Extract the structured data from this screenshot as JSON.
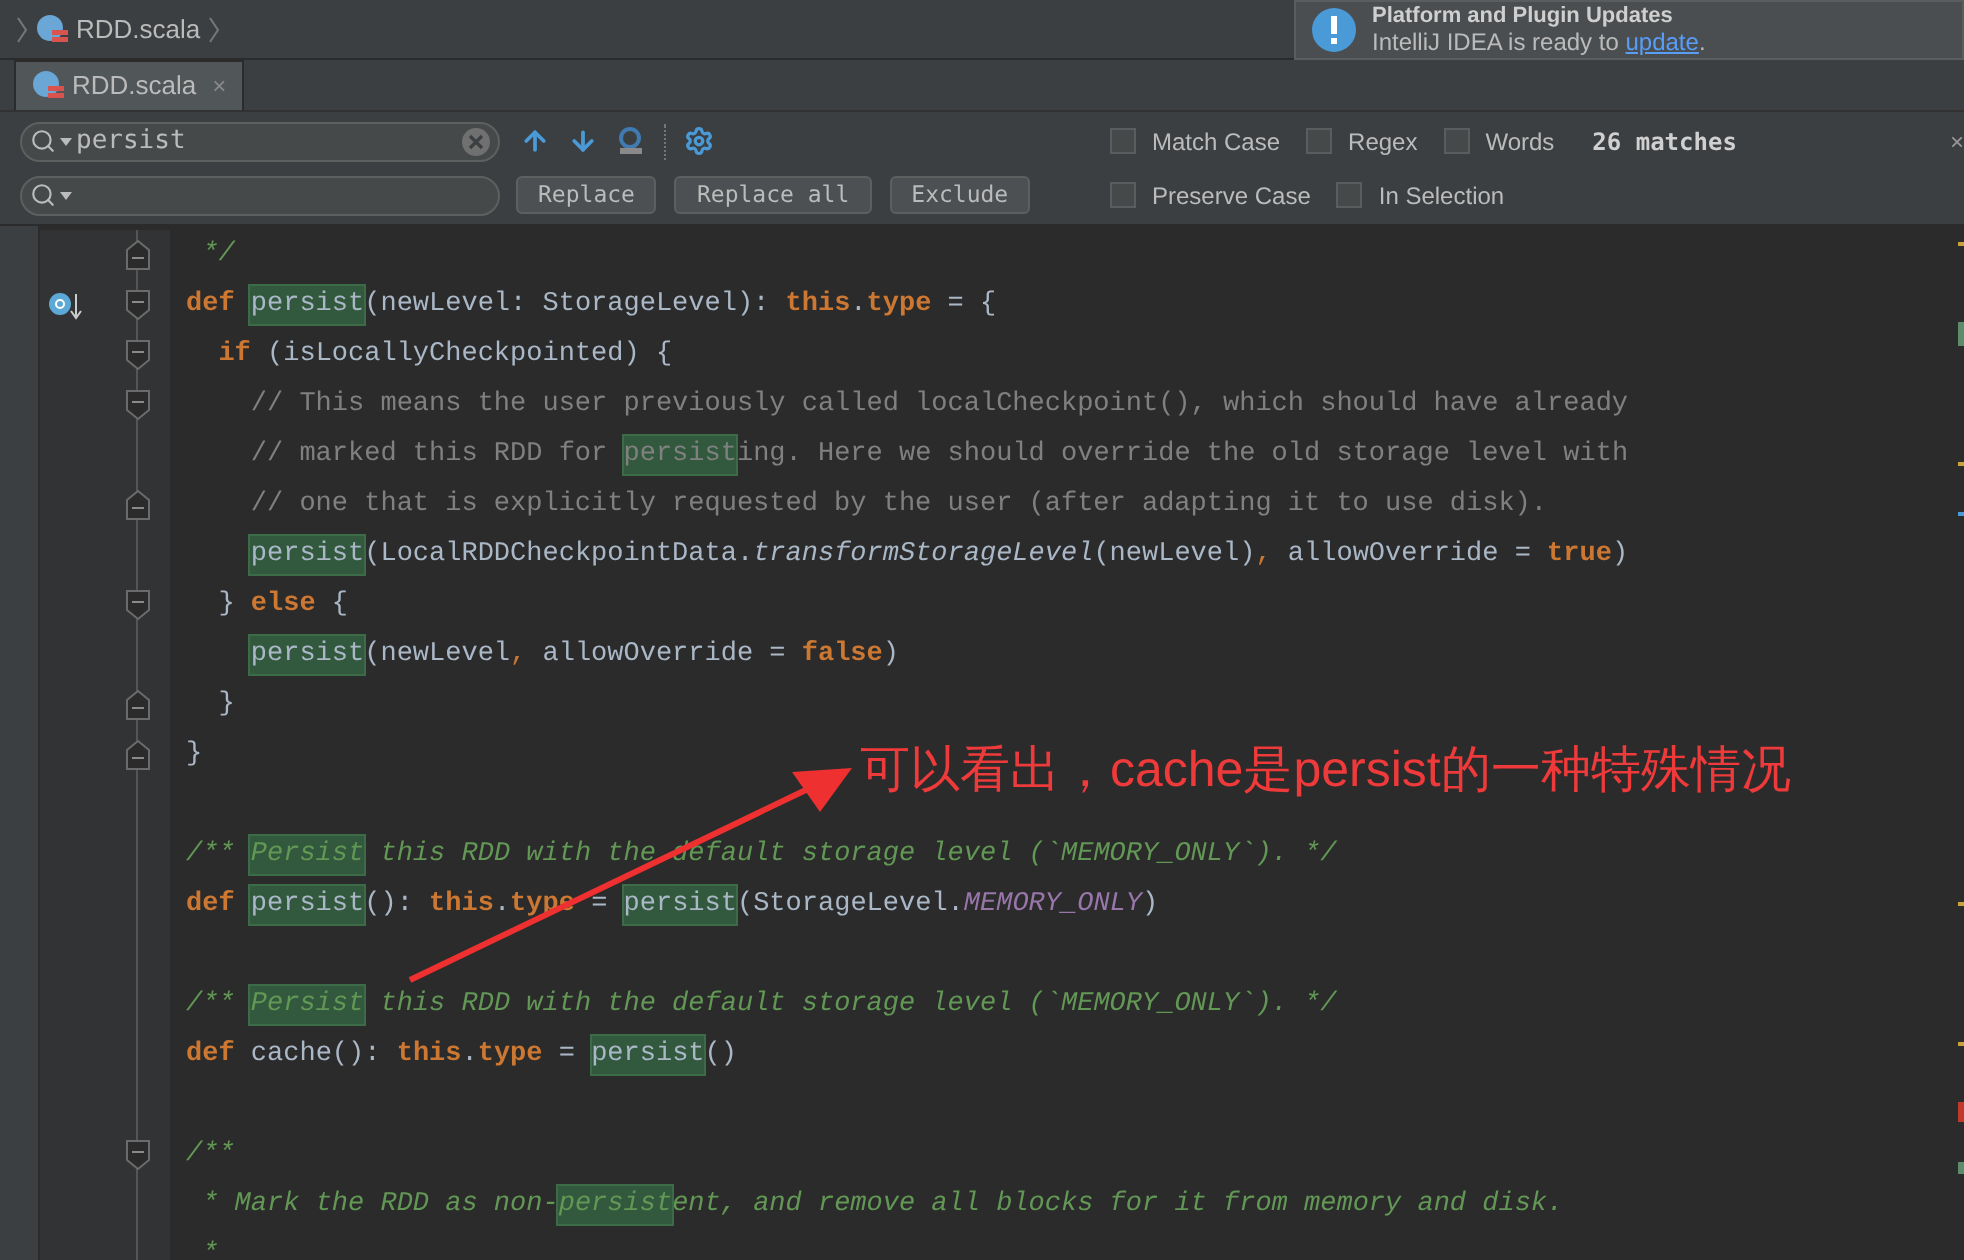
{
  "breadcrumb": {
    "file": "RDD.scala"
  },
  "tabs": [
    {
      "label": "RDD.scala",
      "selected": true,
      "close": "×"
    }
  ],
  "notification": {
    "title": "Platform and Plugin Updates",
    "text": "IntelliJ IDEA is ready to ",
    "link": "update",
    "end": "."
  },
  "search": {
    "value": "persist",
    "options": [
      {
        "label": "Match Case",
        "checked": false
      },
      {
        "label": "Regex",
        "checked": false
      },
      {
        "label": "Words",
        "checked": false
      }
    ],
    "matches": "26 matches",
    "close": "×"
  },
  "replace": {
    "buttons": [
      "Replace",
      "Replace all",
      "Exclude"
    ],
    "options": [
      {
        "label": "Preserve Case",
        "checked": false
      },
      {
        "label": "In Selection",
        "checked": false
      }
    ]
  },
  "code_lines": [
    {
      "fold_start": false,
      "fold_end": true,
      "override_marker": false,
      "tokens": [
        {
          "text": " */",
          "kind": "doc",
          "match": false
        }
      ]
    },
    {
      "fold_start": true,
      "fold_end": false,
      "override_marker": true,
      "tokens": [
        {
          "text": "def ",
          "kind": "keyword",
          "match": false
        },
        {
          "text": "persist",
          "kind": "plain",
          "match": true
        },
        {
          "text": "(newLevel: StorageLevel): ",
          "kind": "plain",
          "match": false
        },
        {
          "text": "this",
          "kind": "keyword",
          "match": false
        },
        {
          "text": ".",
          "kind": "plain",
          "match": false
        },
        {
          "text": "type",
          "kind": "keyword",
          "match": false
        },
        {
          "text": " = {",
          "kind": "plain",
          "match": false
        }
      ]
    },
    {
      "fold_start": true,
      "fold_end": false,
      "override_marker": false,
      "tokens": [
        {
          "text": "  if",
          "kind": "keyword",
          "match": false
        },
        {
          "text": " (isLocallyCheckpointed) {",
          "kind": "plain",
          "match": false
        }
      ]
    },
    {
      "fold_start": true,
      "fold_end": false,
      "override_marker": false,
      "tokens": [
        {
          "text": "    // This means the user previously called localCheckpoint(), which should have already",
          "kind": "comment",
          "match": false
        }
      ]
    },
    {
      "fold_start": false,
      "fold_end": false,
      "override_marker": false,
      "tokens": [
        {
          "text": "    // marked this RDD for ",
          "kind": "comment",
          "match": false
        },
        {
          "text": "persist",
          "kind": "comment",
          "match": true
        },
        {
          "text": "ing. Here we should override the old storage level with",
          "kind": "comment",
          "match": false
        }
      ]
    },
    {
      "fold_start": false,
      "fold_end": true,
      "override_marker": false,
      "tokens": [
        {
          "text": "    // one that is explicitly requested by the user (after adapting it to use disk).",
          "kind": "comment",
          "match": false
        }
      ]
    },
    {
      "fold_start": false,
      "fold_end": false,
      "override_marker": false,
      "tokens": [
        {
          "text": "    persist",
          "kind": "plain",
          "match": true
        },
        {
          "text": "(LocalRDDCheckpointData.",
          "kind": "plain",
          "match": false
        },
        {
          "text": "transformStorageLevel",
          "kind": "method",
          "match": false
        },
        {
          "text": "(newLevel)",
          "kind": "plain",
          "match": false
        },
        {
          "text": ", ",
          "kind": "punct",
          "match": false
        },
        {
          "text": "allowOverride = ",
          "kind": "plain",
          "match": false
        },
        {
          "text": "true",
          "kind": "keyword",
          "match": false
        },
        {
          "text": ")",
          "kind": "plain",
          "match": false
        }
      ]
    },
    {
      "fold_start": true,
      "fold_end": false,
      "override_marker": false,
      "tokens": [
        {
          "text": "  } ",
          "kind": "plain",
          "match": false
        },
        {
          "text": "else",
          "kind": "keyword",
          "match": false
        },
        {
          "text": " {",
          "kind": "plain",
          "match": false
        }
      ]
    },
    {
      "fold_start": false,
      "fold_end": false,
      "override_marker": false,
      "tokens": [
        {
          "text": "    persist",
          "kind": "plain",
          "match": true
        },
        {
          "text": "(newLevel",
          "kind": "plain",
          "match": false
        },
        {
          "text": ", ",
          "kind": "punct",
          "match": false
        },
        {
          "text": "allowOverride = ",
          "kind": "plain",
          "match": false
        },
        {
          "text": "false",
          "kind": "keyword",
          "match": false
        },
        {
          "text": ")",
          "kind": "plain",
          "match": false
        }
      ]
    },
    {
      "fold_start": false,
      "fold_end": true,
      "override_marker": false,
      "tokens": [
        {
          "text": "  }",
          "kind": "plain",
          "match": false
        }
      ]
    },
    {
      "fold_start": false,
      "fold_end": true,
      "override_marker": false,
      "tokens": [
        {
          "text": "}",
          "kind": "plain",
          "match": false
        }
      ]
    },
    {
      "fold_start": false,
      "fold_end": false,
      "override_marker": false
    },
    {
      "fold_start": false,
      "fold_end": false,
      "override_marker": false,
      "tokens": [
        {
          "text": "/** ",
          "kind": "doc",
          "match": false
        },
        {
          "text": "Persist",
          "kind": "doc",
          "match": true
        },
        {
          "text": " this RDD with the default storage level (`MEMORY_ONLY`). */",
          "kind": "doc",
          "match": false
        }
      ]
    },
    {
      "fold_start": false,
      "fold_end": false,
      "override_marker": false,
      "tokens": [
        {
          "text": "def ",
          "kind": "keyword",
          "match": false
        },
        {
          "text": "persist",
          "kind": "plain",
          "match": true
        },
        {
          "text": "(): ",
          "kind": "plain",
          "match": false
        },
        {
          "text": "this",
          "kind": "keyword",
          "match": false
        },
        {
          "text": ".",
          "kind": "plain",
          "match": false
        },
        {
          "text": "type",
          "kind": "keyword",
          "match": false
        },
        {
          "text": " = ",
          "kind": "plain",
          "match": false
        },
        {
          "text": "persist",
          "kind": "plain",
          "match": true
        },
        {
          "text": "(StorageLevel.",
          "kind": "plain",
          "match": false
        },
        {
          "text": "MEMORY_ONLY",
          "kind": "constant",
          "match": false
        },
        {
          "text": ")",
          "kind": "plain",
          "match": false
        }
      ]
    },
    {
      "fold_start": false,
      "fold_end": false,
      "override_marker": false
    },
    {
      "fold_start": false,
      "fold_end": false,
      "override_marker": false,
      "tokens": [
        {
          "text": "/** ",
          "kind": "doc",
          "match": false
        },
        {
          "text": "Persist",
          "kind": "doc",
          "match": true
        },
        {
          "text": " this RDD with the default storage level (`MEMORY_ONLY`). */",
          "kind": "doc",
          "match": false
        }
      ]
    },
    {
      "fold_start": false,
      "fold_end": false,
      "override_marker": false,
      "tokens": [
        {
          "text": "def",
          "kind": "keyword",
          "match": false
        },
        {
          "text": " cache(): ",
          "kind": "plain",
          "match": false
        },
        {
          "text": "this",
          "kind": "keyword",
          "match": false
        },
        {
          "text": ".",
          "kind": "plain",
          "match": false
        },
        {
          "text": "type",
          "kind": "keyword",
          "match": false
        },
        {
          "text": " = ",
          "kind": "plain",
          "match": false
        },
        {
          "text": "persist",
          "kind": "plain",
          "match": true
        },
        {
          "text": "()",
          "kind": "plain",
          "match": false
        }
      ]
    },
    {
      "fold_start": false,
      "fold_end": false,
      "override_marker": false
    },
    {
      "fold_start": true,
      "fold_end": false,
      "override_marker": false,
      "tokens": [
        {
          "text": "/**",
          "kind": "doc",
          "match": false
        }
      ]
    },
    {
      "fold_start": false,
      "fold_end": false,
      "override_marker": false,
      "tokens": [
        {
          "text": " * Mark the RDD as non-",
          "kind": "doc",
          "match": false
        },
        {
          "text": "persist",
          "kind": "doc",
          "match": true
        },
        {
          "text": "ent, and remove all blocks for it from memory and disk.",
          "kind": "doc",
          "match": false
        }
      ]
    },
    {
      "fold_start": false,
      "fold_end": false,
      "override_marker": false,
      "tokens": [
        {
          "text": " *",
          "kind": "doc",
          "match": false
        }
      ]
    }
  ],
  "annotation": {
    "text": "可以看出，cache是persist的一种特殊情况"
  }
}
